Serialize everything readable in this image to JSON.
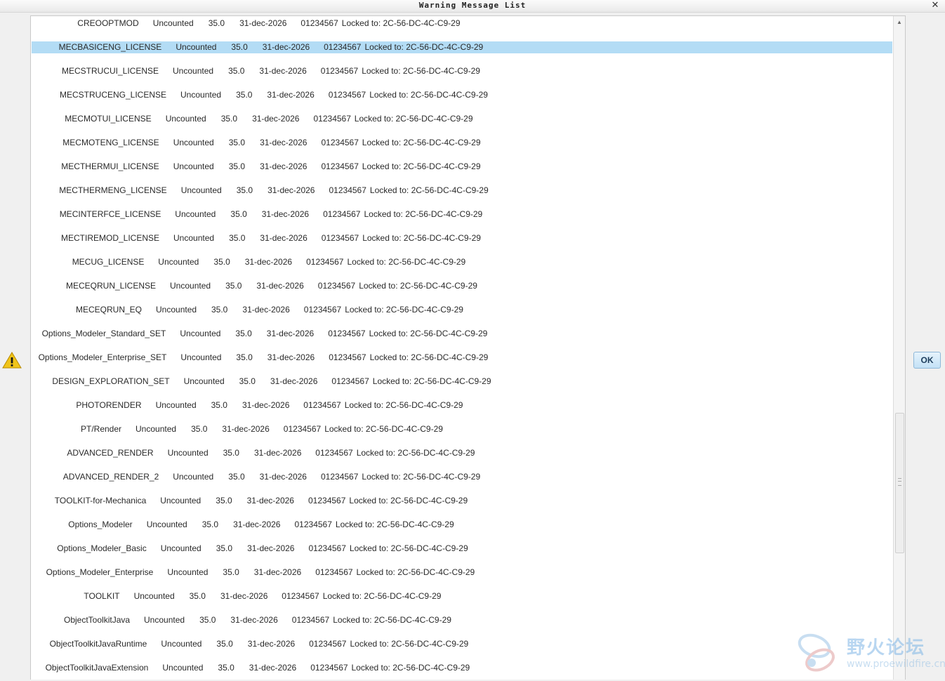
{
  "window": {
    "title": "Warning Message List",
    "close_glyph": "✕"
  },
  "icons": {
    "warning": "warning-triangle-icon",
    "close": "close-icon",
    "scroll_up": "scroll-up-arrow-icon"
  },
  "colors": {
    "selected_row": "#b3dcf5",
    "warning_fill": "#f0c419",
    "ok_button": "#c3e1f6"
  },
  "selected_index": 1,
  "rows": [
    {
      "name": "CREOOPTMOD",
      "count": "Uncounted",
      "version": "35.0",
      "expiry": "31-dec-2026",
      "id": "01234567",
      "locked": "Locked to: 2C-56-DC-4C-C9-29"
    },
    {
      "name": "MECBASICENG_LICENSE",
      "count": "Uncounted",
      "version": "35.0",
      "expiry": "31-dec-2026",
      "id": "01234567",
      "locked": "Locked to: 2C-56-DC-4C-C9-29"
    },
    {
      "name": "MECSTRUCUI_LICENSE",
      "count": "Uncounted",
      "version": "35.0",
      "expiry": "31-dec-2026",
      "id": "01234567",
      "locked": "Locked to: 2C-56-DC-4C-C9-29"
    },
    {
      "name": "MECSTRUCENG_LICENSE",
      "count": "Uncounted",
      "version": "35.0",
      "expiry": "31-dec-2026",
      "id": "01234567",
      "locked": "Locked to: 2C-56-DC-4C-C9-29"
    },
    {
      "name": "MECMOTUI_LICENSE",
      "count": "Uncounted",
      "version": "35.0",
      "expiry": "31-dec-2026",
      "id": "01234567",
      "locked": "Locked to: 2C-56-DC-4C-C9-29"
    },
    {
      "name": "MECMOTENG_LICENSE",
      "count": "Uncounted",
      "version": "35.0",
      "expiry": "31-dec-2026",
      "id": "01234567",
      "locked": "Locked to: 2C-56-DC-4C-C9-29"
    },
    {
      "name": "MECTHERMUI_LICENSE",
      "count": "Uncounted",
      "version": "35.0",
      "expiry": "31-dec-2026",
      "id": "01234567",
      "locked": "Locked to: 2C-56-DC-4C-C9-29"
    },
    {
      "name": "MECTHERMENG_LICENSE",
      "count": "Uncounted",
      "version": "35.0",
      "expiry": "31-dec-2026",
      "id": "01234567",
      "locked": "Locked to: 2C-56-DC-4C-C9-29"
    },
    {
      "name": "MECINTERFCE_LICENSE",
      "count": "Uncounted",
      "version": "35.0",
      "expiry": "31-dec-2026",
      "id": "01234567",
      "locked": "Locked to: 2C-56-DC-4C-C9-29"
    },
    {
      "name": "MECTIREMOD_LICENSE",
      "count": "Uncounted",
      "version": "35.0",
      "expiry": "31-dec-2026",
      "id": "01234567",
      "locked": "Locked to: 2C-56-DC-4C-C9-29"
    },
    {
      "name": "MECUG_LICENSE",
      "count": "Uncounted",
      "version": "35.0",
      "expiry": "31-dec-2026",
      "id": "01234567",
      "locked": "Locked to: 2C-56-DC-4C-C9-29"
    },
    {
      "name": "MECEQRUN_LICENSE",
      "count": "Uncounted",
      "version": "35.0",
      "expiry": "31-dec-2026",
      "id": "01234567",
      "locked": "Locked to: 2C-56-DC-4C-C9-29"
    },
    {
      "name": "MECEQRUN_EQ",
      "count": "Uncounted",
      "version": "35.0",
      "expiry": "31-dec-2026",
      "id": "01234567",
      "locked": "Locked to: 2C-56-DC-4C-C9-29"
    },
    {
      "name": "Options_Modeler_Standard_SET",
      "count": "Uncounted",
      "version": "35.0",
      "expiry": "31-dec-2026",
      "id": "01234567",
      "locked": "Locked to: 2C-56-DC-4C-C9-29"
    },
    {
      "name": "Options_Modeler_Enterprise_SET",
      "count": "Uncounted",
      "version": "35.0",
      "expiry": "31-dec-2026",
      "id": "01234567",
      "locked": "Locked to: 2C-56-DC-4C-C9-29"
    },
    {
      "name": "DESIGN_EXPLORATION_SET",
      "count": "Uncounted",
      "version": "35.0",
      "expiry": "31-dec-2026",
      "id": "01234567",
      "locked": "Locked to: 2C-56-DC-4C-C9-29"
    },
    {
      "name": "PHOTORENDER",
      "count": "Uncounted",
      "version": "35.0",
      "expiry": "31-dec-2026",
      "id": "01234567",
      "locked": "Locked to: 2C-56-DC-4C-C9-29"
    },
    {
      "name": "PT/Render",
      "count": "Uncounted",
      "version": "35.0",
      "expiry": "31-dec-2026",
      "id": "01234567",
      "locked": "Locked to: 2C-56-DC-4C-C9-29"
    },
    {
      "name": "ADVANCED_RENDER",
      "count": "Uncounted",
      "version": "35.0",
      "expiry": "31-dec-2026",
      "id": "01234567",
      "locked": "Locked to: 2C-56-DC-4C-C9-29"
    },
    {
      "name": "ADVANCED_RENDER_2",
      "count": "Uncounted",
      "version": "35.0",
      "expiry": "31-dec-2026",
      "id": "01234567",
      "locked": "Locked to: 2C-56-DC-4C-C9-29"
    },
    {
      "name": "TOOLKIT-for-Mechanica",
      "count": "Uncounted",
      "version": "35.0",
      "expiry": "31-dec-2026",
      "id": "01234567",
      "locked": "Locked to: 2C-56-DC-4C-C9-29"
    },
    {
      "name": "Options_Modeler",
      "count": "Uncounted",
      "version": "35.0",
      "expiry": "31-dec-2026",
      "id": "01234567",
      "locked": "Locked to: 2C-56-DC-4C-C9-29"
    },
    {
      "name": "Options_Modeler_Basic",
      "count": "Uncounted",
      "version": "35.0",
      "expiry": "31-dec-2026",
      "id": "01234567",
      "locked": "Locked to: 2C-56-DC-4C-C9-29"
    },
    {
      "name": "Options_Modeler_Enterprise",
      "count": "Uncounted",
      "version": "35.0",
      "expiry": "31-dec-2026",
      "id": "01234567",
      "locked": "Locked to: 2C-56-DC-4C-C9-29"
    },
    {
      "name": "TOOLKIT",
      "count": "Uncounted",
      "version": "35.0",
      "expiry": "31-dec-2026",
      "id": "01234567",
      "locked": "Locked to: 2C-56-DC-4C-C9-29"
    },
    {
      "name": "ObjectToolkitJava",
      "count": "Uncounted",
      "version": "35.0",
      "expiry": "31-dec-2026",
      "id": "01234567",
      "locked": "Locked to: 2C-56-DC-4C-C9-29"
    },
    {
      "name": "ObjectToolkitJavaRuntime",
      "count": "Uncounted",
      "version": "35.0",
      "expiry": "31-dec-2026",
      "id": "01234567",
      "locked": "Locked to: 2C-56-DC-4C-C9-29"
    },
    {
      "name": "ObjectToolkitJavaExtension",
      "count": "Uncounted",
      "version": "35.0",
      "expiry": "31-dec-2026",
      "id": "01234567",
      "locked": "Locked to: 2C-56-DC-4C-C9-29"
    }
  ],
  "buttons": {
    "ok_label": "OK"
  },
  "watermark": {
    "logo": "proewildfire-logo",
    "text_cn": "野火论坛",
    "url": "www.proewildfire.cn"
  }
}
